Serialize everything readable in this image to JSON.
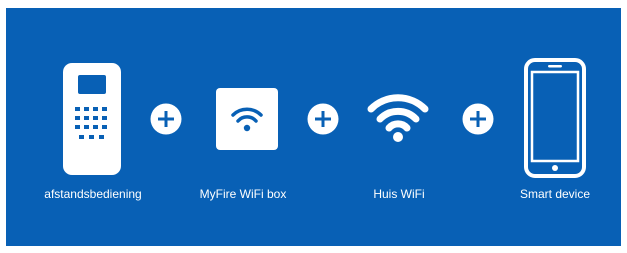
{
  "colors": {
    "background": "#0860b5",
    "foreground": "#ffffff"
  },
  "steps": [
    {
      "label": "afstandsbediening",
      "icon": "remote-control-icon"
    },
    {
      "label": "MyFire WiFi box",
      "icon": "wifi-box-icon"
    },
    {
      "label": "Huis WiFi",
      "icon": "wifi-icon"
    },
    {
      "label": "Smart device",
      "icon": "smartphone-icon"
    }
  ],
  "connector_icon": "plus-circle-icon"
}
